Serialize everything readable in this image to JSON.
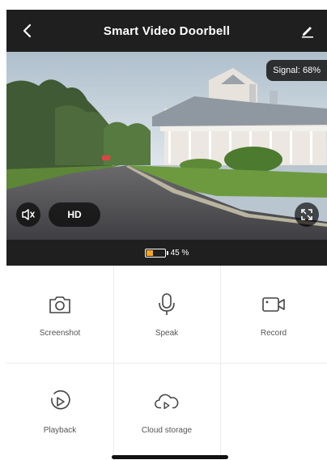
{
  "header": {
    "title": "Smart Video Doorbell",
    "back_icon": "chevron-left-icon",
    "edit_icon": "pencil-icon"
  },
  "video": {
    "signal_label": "Signal: 68%",
    "quality_label": "HD",
    "mute_icon": "speaker-muted-icon",
    "fullscreen_icon": "fullscreen-icon"
  },
  "battery": {
    "percent": 45,
    "label": "45 %",
    "color": "#f5a623"
  },
  "actions": [
    {
      "label": "Screenshot",
      "icon": "camera-icon"
    },
    {
      "label": "Speak",
      "icon": "microphone-icon"
    },
    {
      "label": "Record",
      "icon": "video-camera-icon"
    },
    {
      "label": "Playback",
      "icon": "playback-icon"
    },
    {
      "label": "Cloud storage",
      "icon": "cloud-storage-icon"
    }
  ],
  "colors": {
    "header_bg": "#1f1f1f",
    "accent": "#f5a623"
  }
}
